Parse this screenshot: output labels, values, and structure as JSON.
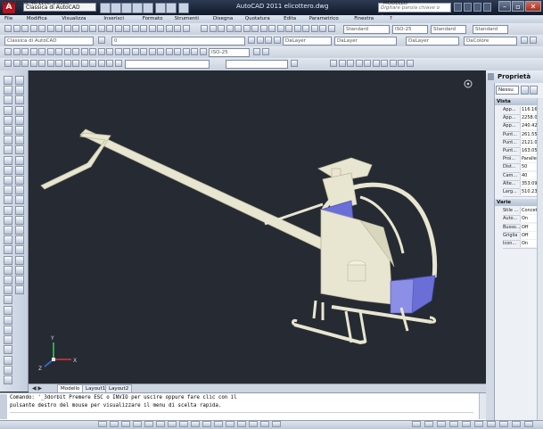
{
  "window": {
    "app_icon": "A",
    "workspace": "Classica di AutoCAD",
    "title": "AutoCAD 2011   elicottero.dwg",
    "search_placeholder": "Digitare parola chiave o frase",
    "controls": [
      "minimize-icon",
      "restore-icon",
      "close-icon"
    ]
  },
  "menu": [
    "File",
    "Modifica",
    "Visualizza",
    "Inserisci",
    "Formato",
    "Strumenti",
    "Disegna",
    "Quotatura",
    "Edita",
    "Parametrico",
    "Finestra",
    "?"
  ],
  "toolbars": {
    "workspace_select": "Classica di AutoCAD",
    "layer_select": "0",
    "text_style": "Standard",
    "dim_style": "ISO-25",
    "table_style": "Standard",
    "mleader_style": "Standard",
    "color": "DaLayer",
    "linetype": "DaLayer",
    "lineweight": "DaLayer",
    "color2": "DaColore",
    "ml_style": "ISO-25"
  },
  "tabs": [
    "Modello",
    "Layout1",
    "Layout2"
  ],
  "command": {
    "line1": "Comando: '_3dorbit Premere ESC o INVIO per uscire oppure fare clic con il",
    "line2": "pulsante destro del mouse per visualizzare il menu di scelta rapida."
  },
  "status": {
    "coords": "1509.5503, 46.1106, 0.0000",
    "mode": "MODELLO"
  },
  "properties": {
    "title": "Proprietà",
    "selection": "Nessu",
    "sections": [
      {
        "name": "Vista",
        "rows": [
          {
            "key": "App...",
            "value": "116.1663"
          },
          {
            "key": "App...",
            "value": "2258.073"
          },
          {
            "key": "App...",
            "value": "240.4234"
          },
          {
            "key": "Punt...",
            "value": "261.5537"
          },
          {
            "key": "Punt...",
            "value": "2121.019"
          },
          {
            "key": "Punt...",
            "value": "163.0595"
          },
          {
            "key": "Proi...",
            "value": "Parallela"
          },
          {
            "key": "Dist...",
            "value": "50"
          },
          {
            "key": "Cam...",
            "value": "40"
          },
          {
            "key": "Alte...",
            "value": "353.0902"
          },
          {
            "key": "Larg...",
            "value": "510.2375"
          }
        ]
      },
      {
        "name": "Varie",
        "rows": [
          {
            "key": "Stile ...",
            "value": "Concettu..."
          },
          {
            "key": "Auto...",
            "value": "On"
          },
          {
            "key": "Busso...",
            "value": "Off"
          },
          {
            "key": "Griglia",
            "value": "Off"
          },
          {
            "key": "Icon...",
            "value": "On"
          }
        ]
      }
    ]
  },
  "ucs_axes": {
    "x": "X",
    "y": "Y",
    "z": "Z"
  },
  "colors": {
    "viewport_bg": "#262b33",
    "model_fill": "#e8e6d0",
    "model_glass": "#6a6fd8"
  }
}
